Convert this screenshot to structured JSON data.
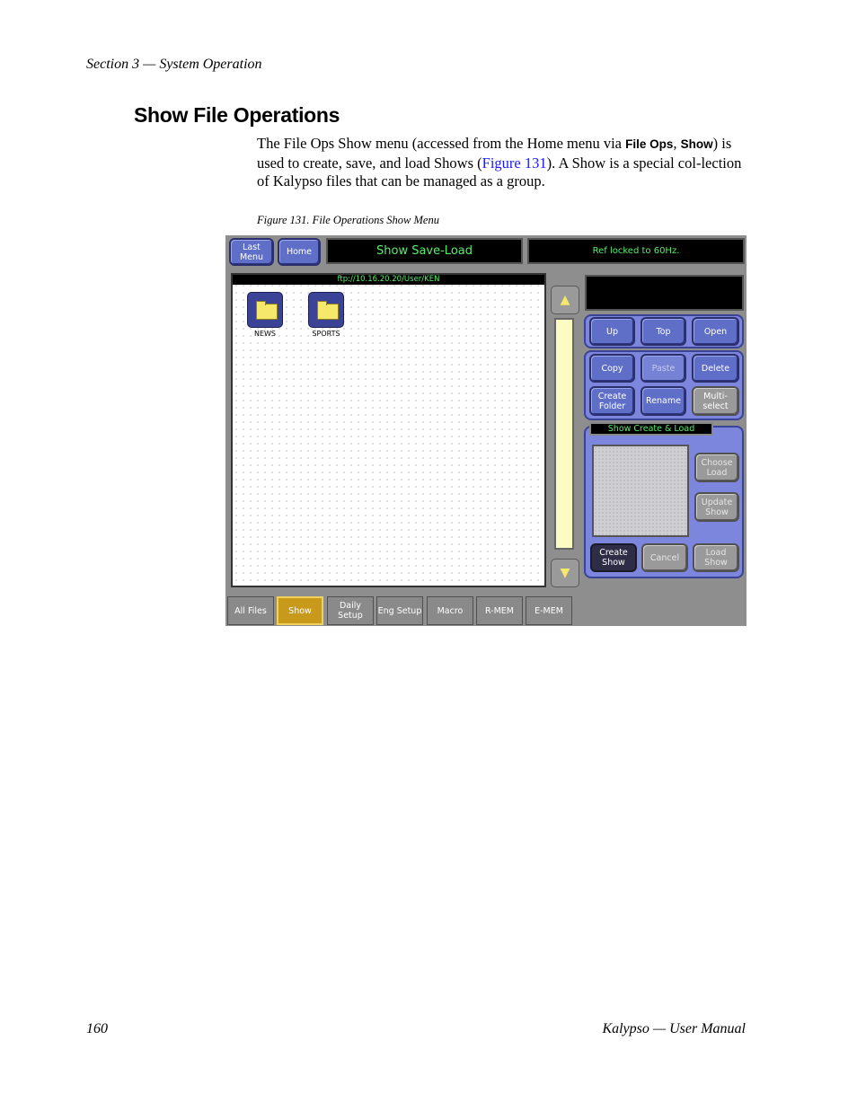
{
  "header": {
    "section": "Section 3 — System Operation"
  },
  "heading": "Show File Operations",
  "paragraph": {
    "text1": "The File Ops Show menu (accessed from the Home menu via ",
    "ui1": "File Ops",
    "sep": ", ",
    "ui2": "Show",
    "text2": ") is used to create, save, and load Shows (",
    "link": "Figure 131",
    "text3": "). A Show is a special col-lection of Kalypso files that can be managed as a group."
  },
  "caption": "Figure 131.  File Operations Show Menu",
  "figure": {
    "top": {
      "last_menu": "Last Menu",
      "home": "Home",
      "menu_title": "Show Save-Load",
      "status": "Ref locked to 60Hz."
    },
    "path": "ftp://10.16.20.20/User/KEN",
    "folders": [
      "NEWS",
      "SPORTS"
    ],
    "scroll_up_icon": "▲",
    "scroll_down_icon": "▼",
    "nav_buttons": {
      "up": "Up",
      "top": "Top",
      "open": "Open"
    },
    "edit_buttons": {
      "copy": "Copy",
      "paste": "Paste",
      "delete": "Delete",
      "create_folder": "Create Folder",
      "rename": "Rename",
      "multi_select": "Multi-select"
    },
    "show_panel": {
      "title": "Show Create & Load",
      "choose_load": "Choose Load",
      "update_show": "Update Show",
      "create_show": "Create Show",
      "cancel": "Cancel",
      "load_show": "Load Show"
    },
    "tabs": [
      "All Files",
      "Show",
      "Daily Setup",
      "Eng Setup",
      "Macro",
      "R-MEM",
      "E-MEM"
    ],
    "colors": {
      "accent": "#5f6fc8",
      "display_text": "#54f06a",
      "active_tab": "#c79a1c"
    }
  },
  "footer": {
    "page": "160",
    "manual": "Kalypso — User Manual"
  }
}
